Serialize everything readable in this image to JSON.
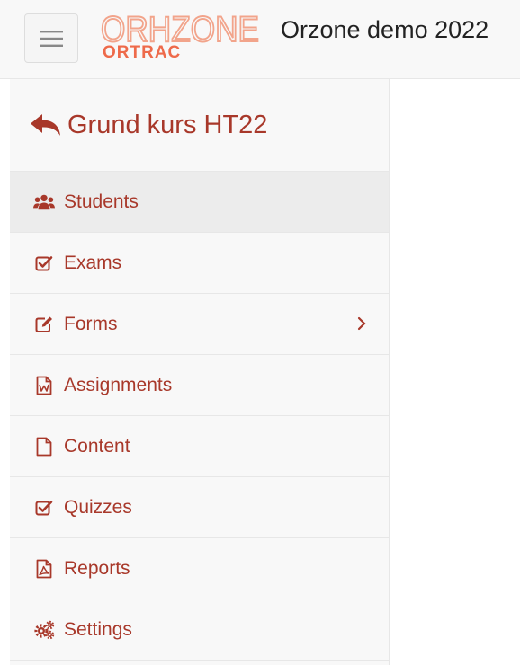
{
  "header": {
    "logo_text": "ORHZONE",
    "logo_subtext": "ORTRAC",
    "app_title": "Orzone demo 2022"
  },
  "sidebar": {
    "course_title": "Grund kurs HT22",
    "items": [
      {
        "label": "Students",
        "icon": "users-icon",
        "active": true
      },
      {
        "label": "Exams",
        "icon": "check-square-icon"
      },
      {
        "label": "Forms",
        "icon": "edit-icon",
        "has_submenu": true
      },
      {
        "label": "Assignments",
        "icon": "word-file-icon"
      },
      {
        "label": "Content",
        "icon": "file-icon"
      },
      {
        "label": "Quizzes",
        "icon": "check-square-icon"
      },
      {
        "label": "Reports",
        "icon": "pdf-file-icon"
      },
      {
        "label": "Settings",
        "icon": "cogs-icon"
      }
    ]
  },
  "colors": {
    "accent": "#a8382a",
    "logo_light": "#f2a48b",
    "logo_dark": "#ee6a4a",
    "text_dark": "#222222"
  }
}
